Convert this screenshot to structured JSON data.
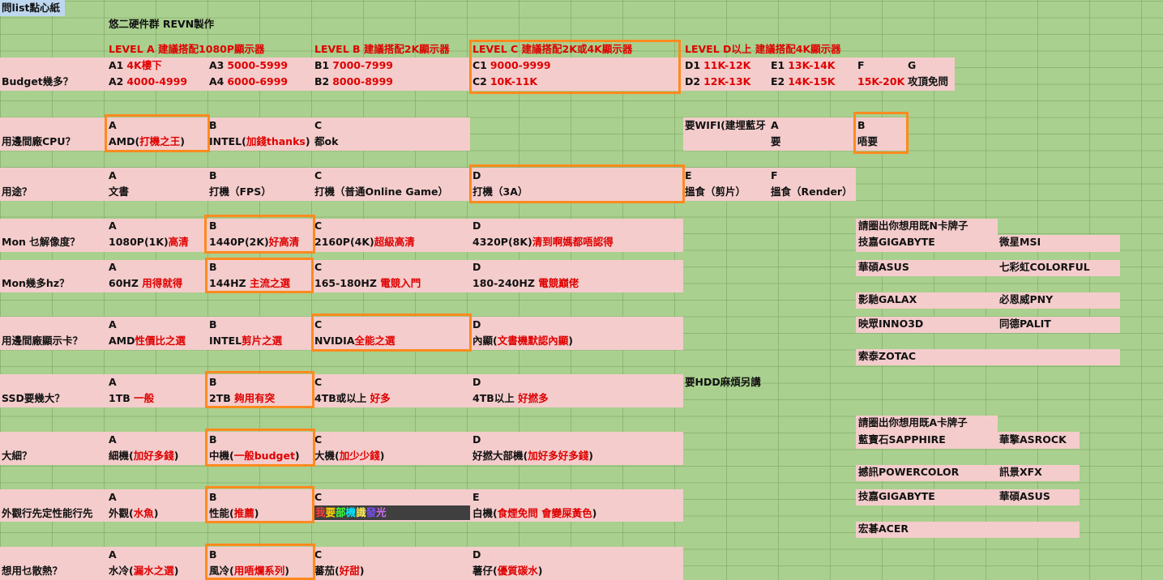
{
  "sheet_title": "問list點心紙",
  "credit": "悠二硬件群 REVN製作",
  "levels": {
    "a": "LEVEL A 建議搭配1080P顯示器",
    "b": "LEVEL B 建議搭配2K顯示器",
    "c": "LEVEL C 建議搭配2K或4K顯示器",
    "d": "LEVEL D以上 建議搭配4K顯示器"
  },
  "budget": {
    "question": "Budget幾多？",
    "a1": {
      "code": "A1",
      "range": "4K樓下"
    },
    "a3": {
      "code": "A3",
      "range": "5000-5999"
    },
    "b1": {
      "code": "B1",
      "range": "7000-7999"
    },
    "c1": {
      "code": "C1",
      "range": "9000-9999"
    },
    "d1": {
      "code": "D1",
      "range": "11K-12K"
    },
    "e1": {
      "code": "E1",
      "range": "13K-14K"
    },
    "f_code": "F",
    "g_code": "G",
    "a2": {
      "code": "A2",
      "range": "4000-4999"
    },
    "a4": {
      "code": "A4",
      "range": "6000-6999"
    },
    "b2": {
      "code": "B2",
      "range": "8000-8999"
    },
    "c2": {
      "code": "C2",
      "range": "10K-11K"
    },
    "d2": {
      "code": "D2",
      "range": "12K-13K"
    },
    "e2": {
      "code": "E2",
      "range": "14K-15K"
    },
    "f_range": "15K-20K",
    "g_text": "攻頂免問"
  },
  "cpu": {
    "question": "用邊間廠CPU？",
    "a_code": "A",
    "a_main": "AMD(",
    "a_red": "打機之王",
    "a_close": ")",
    "b_code": "B",
    "b_main": "INTEL(",
    "b_red": "加錢thanks",
    "b_close": ")",
    "c_code": "C",
    "c_main": "都ok"
  },
  "wifi": {
    "question": "要WIFI(建埋藍牙",
    "a_code": "A",
    "a_text": "要",
    "b_code": "B",
    "b_text": "唔要"
  },
  "usage": {
    "question": "用途？",
    "opts": [
      {
        "code": "A",
        "text": "文書"
      },
      {
        "code": "B",
        "text": "打機（FPS）"
      },
      {
        "code": "C",
        "text": "打機（普通Online Game）"
      },
      {
        "code": "D",
        "text": "打機（3A）"
      },
      {
        "code": "E",
        "text": "搵食（剪片）"
      },
      {
        "code": "F",
        "text": "搵食（Render）"
      }
    ]
  },
  "resolution": {
    "question": "Mon 乜解像度？",
    "opts": [
      {
        "code": "A",
        "main": "1080P(1K)",
        "red": "高清"
      },
      {
        "code": "B",
        "main": "1440P(2K)",
        "red": "好高清"
      },
      {
        "code": "C",
        "main": "2160P(4K)",
        "red": "超級高清"
      },
      {
        "code": "D",
        "main": "4320P(8K)",
        "red": "清到啊媽都唔認得"
      }
    ]
  },
  "hz": {
    "question": "Mon幾多hz？",
    "opts": [
      {
        "code": "A",
        "main": "60HZ ",
        "red": "用得就得"
      },
      {
        "code": "B",
        "main": "144HZ ",
        "red": "主流之選"
      },
      {
        "code": "C",
        "main": "165-180HZ ",
        "red": "電競入門"
      },
      {
        "code": "D",
        "main": "180-240HZ ",
        "red": "電競巔佬"
      }
    ]
  },
  "gpu": {
    "question": "用邊間廠顯示卡？",
    "a_code": "A",
    "a_main": "AMD",
    "a_red": "性價比之選",
    "b_code": "B",
    "b_main": "INTEL",
    "b_red": "剪片之選",
    "c_code": "C",
    "c_main": "NVIDIA",
    "c_red": "全能之選",
    "d_code": "D",
    "d_main": "內顯(",
    "d_red": "文書機默認內顯",
    "d_close": ")"
  },
  "ssd": {
    "question": "SSD要幾大？",
    "opts": [
      {
        "code": "A",
        "main": "1TB ",
        "red": "一般"
      },
      {
        "code": "B",
        "main": "2TB ",
        "red": "夠用有突"
      },
      {
        "code": "C",
        "main": "4TB或以上 ",
        "red": "好多"
      },
      {
        "code": "D",
        "main": "4TB以上 ",
        "red": "好撚多"
      }
    ],
    "hdd_question": "要HDD麻煩另講"
  },
  "size": {
    "question": "大細？",
    "opts": [
      {
        "code": "A",
        "main": "細機(",
        "red": "加好多錢",
        "close": ")"
      },
      {
        "code": "B",
        "main": "中機(",
        "red": "一般budget",
        "close": ")"
      },
      {
        "code": "C",
        "main": "大機(",
        "red": "加少少錢",
        "close": ")"
      },
      {
        "code": "D",
        "main": "好撚大部機(",
        "red": "加好多好多錢",
        "close": ")"
      }
    ]
  },
  "looks": {
    "question": "外觀行先定性能行先",
    "a_code": "A",
    "a_main": "外觀(",
    "a_red": "水魚",
    "a_close": ")",
    "b_code": "B",
    "b_main": "性能(",
    "b_red": "推薦",
    "b_close": ")",
    "c_code": "C",
    "rgb_chars": [
      {
        "t": "我",
        "color": "#ff3b3b"
      },
      {
        "t": "要",
        "color": "#ffd400"
      },
      {
        "t": "部",
        "color": "#3cff3c"
      },
      {
        "t": "機",
        "color": "#00e5ff"
      },
      {
        "t": "識",
        "color": "#ffee58"
      },
      {
        "t": "發",
        "color": "#7c4dff"
      },
      {
        "t": "光",
        "color": "#d36bff"
      }
    ],
    "e_code": "E",
    "e_main": "白機(",
    "e_red": "食煙免問 會變屎黃色",
    "e_close": ")"
  },
  "cooling": {
    "question": "想用乜散熱？",
    "opts": [
      {
        "code": "A",
        "main": "水冷(",
        "red": "漏水之選",
        "close": ")"
      },
      {
        "code": "B",
        "main": "風冷(",
        "red": "用唔爛系列",
        "close": ")"
      },
      {
        "code": "C",
        "main": "蕃茄(",
        "red": "好甜",
        "close": ")"
      },
      {
        "code": "D",
        "main": "薯仔(",
        "red": "優質碳水",
        "close": ")"
      }
    ]
  },
  "nvidia_brands": {
    "title": "請圈出你想用既N卡牌子",
    "items": [
      "技嘉GIGABYTE",
      "微星MSI",
      "華碩ASUS",
      "七彩虹COLORFUL",
      "影馳GALAX",
      "必恩威PNY",
      "映眾INNO3D",
      "同德PALIT",
      "索泰ZOTAC"
    ]
  },
  "amd_brands": {
    "title": "請圈出你想用既A卡牌子",
    "items": [
      "藍寶石SAPPHIRE",
      "華擎ASROCK",
      "撼訊POWERCOLOR",
      "訊景XFX",
      "技嘉GIGABYTE",
      "華碩ASUS",
      "宏碁ACER"
    ]
  },
  "colors": {
    "grid_green": "#a9d08e",
    "pink": "#f4cccc",
    "red_text": "#e00000",
    "highlight": "#ff8a1f",
    "title_blue": "#bdd7ee"
  }
}
